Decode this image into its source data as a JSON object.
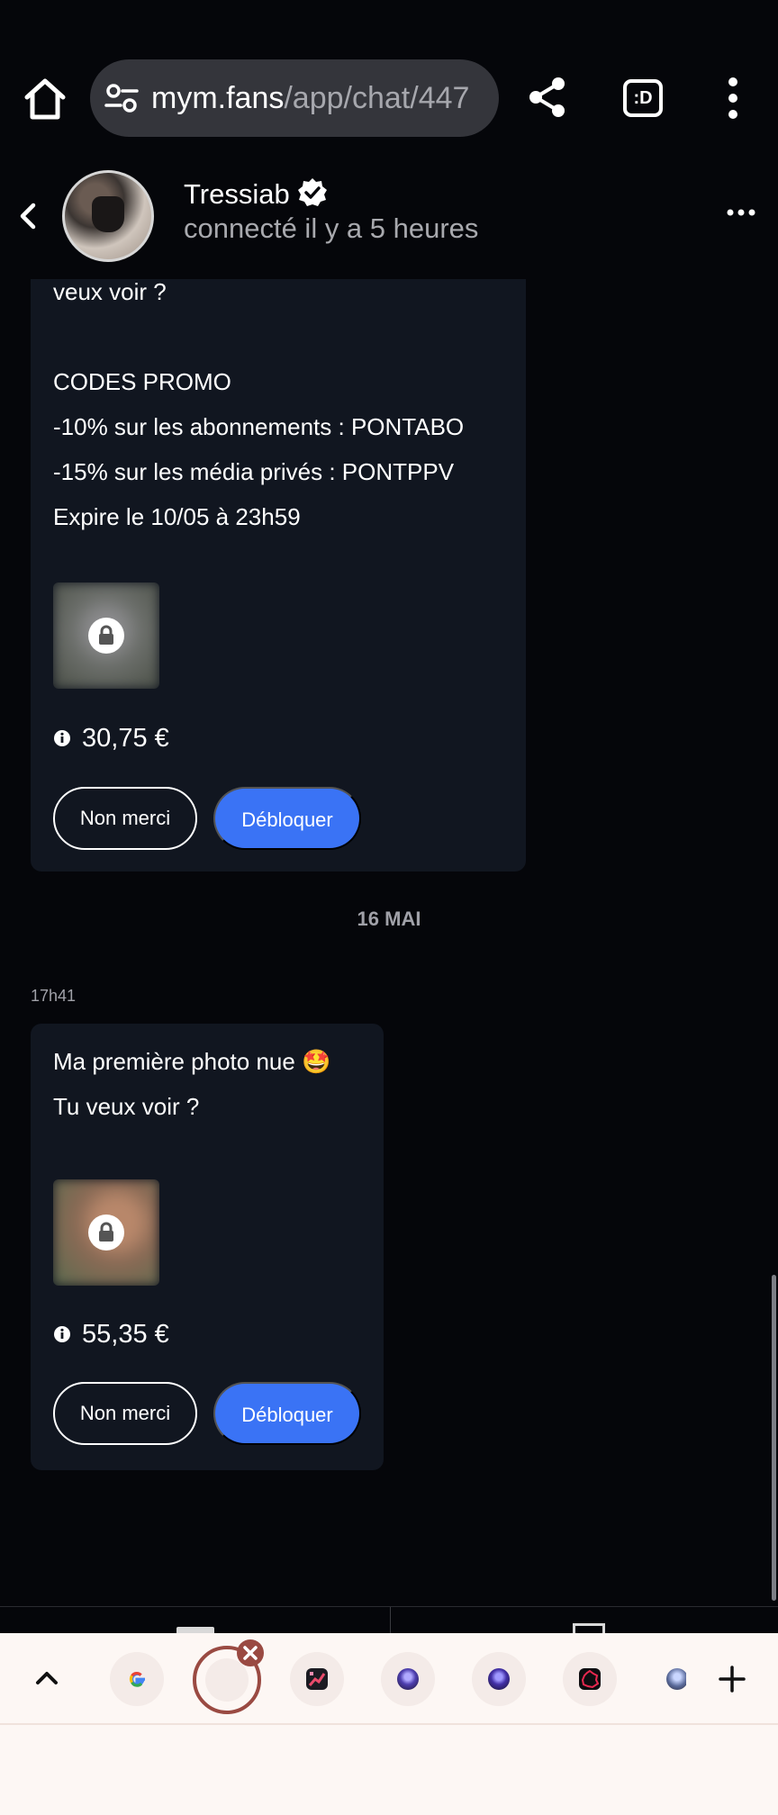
{
  "browser": {
    "url_domain": "mym.fans",
    "url_path": "/app/chat/447",
    "tab_count_label": ":D",
    "icons": [
      "home-icon",
      "site-settings-icon",
      "share-icon",
      "tab-switcher-icon",
      "more-vert-icon"
    ]
  },
  "chat_header": {
    "name": "Tressiab",
    "status": "connecté il y a 5 heures",
    "icons": [
      "back-arrow-icon",
      "verified-badge-icon",
      "more-horiz-icon"
    ]
  },
  "messages": [
    {
      "lines": [
        "veux voir ?",
        "",
        "CODES PROMO",
        "-10% sur les abonnements : PONTABO",
        "-15% sur les média privés : PONTPPV",
        "Expire le 10/05 à 23h59"
      ],
      "price": "30,75 €",
      "decline_label": "Non merci",
      "unlock_label": "Débloquer"
    },
    {
      "time": "17h41",
      "lines": [
        "Ma première photo nue 🤩",
        "Tu veux voir ?"
      ],
      "price": "55,35 €",
      "decline_label": "Non merci",
      "unlock_label": "Débloquer"
    }
  ],
  "date_separator": "16 MAI",
  "tab_strip": {
    "icons": [
      "chevron-up-icon",
      "google-tab-icon",
      "active-tab-icon",
      "close-tab-icon",
      "chart-tab-icon",
      "avatar-tab-icon",
      "avatar-tab-icon",
      "map-tab-icon",
      "partial-tab-icon",
      "add-tab-icon"
    ]
  },
  "colors": {
    "background": "#05060a",
    "bubble": "#111620",
    "accent": "#3a73f5",
    "url_pill": "#34353b",
    "tab_strip": "#fdf7f4",
    "close_badge": "#9a4a42"
  }
}
